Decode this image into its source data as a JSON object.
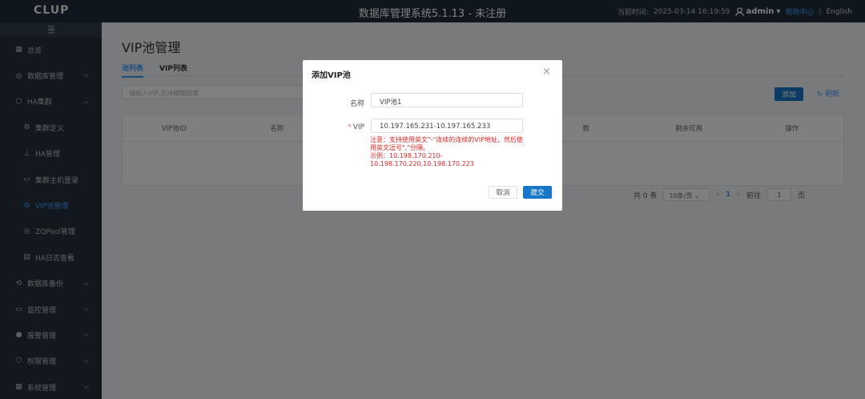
{
  "header": {
    "logo": "CLUP",
    "title": "数据库管理系统5.1.13 - 未注册",
    "time_label": "当前时间:",
    "time_value": "2025-03-14 16:19:59",
    "user": "admin",
    "link_blue": "帮助中心",
    "separator": "|",
    "lang": "English"
  },
  "sidebar": {
    "items": [
      {
        "label": "总览",
        "icon": "grid-icon",
        "sub": false
      },
      {
        "label": "数据库管理",
        "icon": "database-icon",
        "sub": false,
        "chevron": "down"
      },
      {
        "label": "HA集群",
        "icon": "cluster-icon",
        "sub": false,
        "chevron": "up"
      },
      {
        "label": "集群定义",
        "icon": "settings-icon",
        "sub": true
      },
      {
        "label": "HA管理",
        "icon": "sitemap-icon",
        "sub": true
      },
      {
        "label": "集群主机登录",
        "icon": "monitor-icon",
        "sub": true
      },
      {
        "label": "VIP池管理",
        "icon": "gear-icon",
        "sub": true,
        "active": true
      },
      {
        "label": "ZQPool管理",
        "icon": "target-icon",
        "sub": true
      },
      {
        "label": "HA日志查看",
        "icon": "log-icon",
        "sub": true
      },
      {
        "label": "数据库备份",
        "icon": "backup-icon",
        "sub": false,
        "chevron": "down"
      },
      {
        "label": "监控管理",
        "icon": "monitor-icon",
        "sub": false,
        "chevron": "down"
      },
      {
        "label": "报警管理",
        "icon": "alert-icon",
        "sub": false,
        "chevron": "down"
      },
      {
        "label": "权限管理",
        "icon": "shield-icon",
        "sub": false,
        "chevron": "down"
      },
      {
        "label": "系统管理",
        "icon": "grid-icon",
        "sub": false,
        "chevron": "down"
      }
    ]
  },
  "main": {
    "title": "VIP池管理",
    "tabs": [
      "池列表",
      "VIP列表"
    ],
    "search_placeholder": "请输入VIP,支持模糊搜索",
    "add_label": "添加",
    "refresh_label": "刷新",
    "columns": [
      "VIP池ID",
      "名称",
      "",
      "",
      "数",
      "剩余可用",
      "操作"
    ],
    "pager": {
      "total": "共 0 条",
      "page_size": "10条/页",
      "current": "1",
      "goto_label": "前往",
      "goto_value": "1",
      "page_unit": "页"
    }
  },
  "dialog": {
    "title": "添加VIP池",
    "name_label": "名称",
    "name_value": "VIP池1",
    "vip_label": "VIP",
    "vip_value": "10.197.165.231-10.197.165.233",
    "note": "注意：支持使用英文\"-\"连续的连续的VIP地址，然后使用英文逗号\",\"分隔。",
    "example": "示例：10.198.170.210-10.198.170.220,10.198.170.223",
    "cancel_label": "取消",
    "submit_label": "提交"
  },
  "colors": {
    "header_bg": "#1f2d3d",
    "sidebar_bg": "#26313e",
    "accent": "#409eff",
    "primary_button": "#1677c8",
    "warning_text": "#e02424"
  }
}
